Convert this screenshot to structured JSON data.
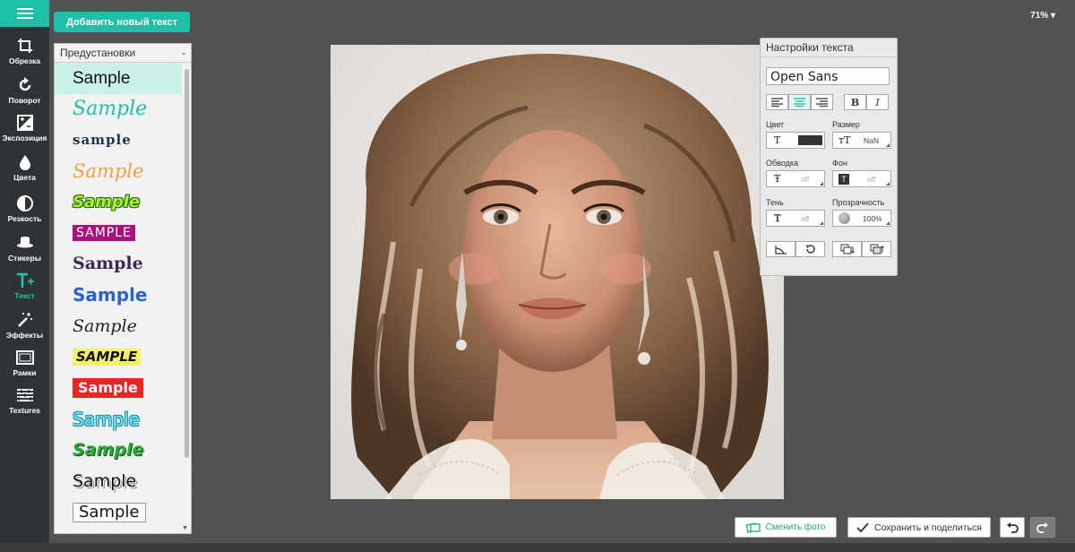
{
  "toolbar": {
    "add_text": "Добавить новый текст",
    "zoom": "71%"
  },
  "tools": [
    {
      "label": "Обрезка",
      "icon": "crop-icon"
    },
    {
      "label": "Поворот",
      "icon": "rotate-icon"
    },
    {
      "label": "Экспозиция",
      "icon": "exposure-icon"
    },
    {
      "label": "Цвета",
      "icon": "drop-icon"
    },
    {
      "label": "Резкость",
      "icon": "sharpness-icon"
    },
    {
      "label": "Стикеры",
      "icon": "hat-icon"
    },
    {
      "label": "Текст",
      "icon": "text-icon",
      "active": true
    },
    {
      "label": "Эффекты",
      "icon": "magic-wand-icon"
    },
    {
      "label": "Рамки",
      "icon": "frame-icon"
    },
    {
      "label": "Textures",
      "icon": "texture-icon"
    }
  ],
  "presets": {
    "title": "Предустановки",
    "collapse": "-",
    "items": [
      "Sample",
      "Sample",
      "sample",
      "Sample",
      "Sample",
      "SAMPLE",
      "Sample",
      "Sample",
      "Sample",
      "SAMPLE",
      "Sample",
      "Sample",
      "Sample",
      "Sample",
      "Sample"
    ]
  },
  "settings": {
    "title": "Настройки текста",
    "font": "Open Sans",
    "color_label": "Цвет",
    "color_value": "#333333",
    "size_label": "Размер",
    "size_value": "NaN",
    "stroke_label": "Обводка",
    "stroke_value": "off",
    "bg_label": "Фон",
    "bg_value": "off",
    "shadow_label": "Тень",
    "shadow_value": "off",
    "opacity_label": "Прозрачность",
    "opacity_value": "100%",
    "bold": "B",
    "italic": "I"
  },
  "bottom": {
    "change_photo": "Сменить фото",
    "save_share": "Сохранить и поделиться"
  },
  "colors": {
    "accent": "#20c0a8",
    "sidebar": "#2f3335"
  }
}
